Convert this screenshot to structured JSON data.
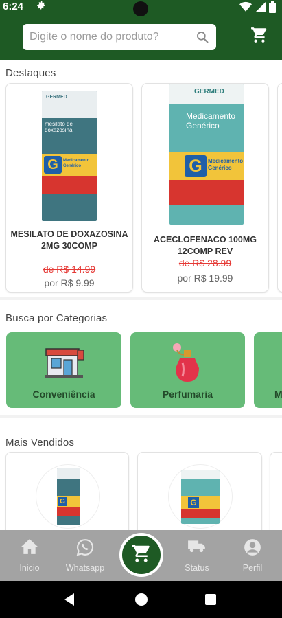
{
  "status_bar": {
    "time": "6:24"
  },
  "header": {
    "search_placeholder": "Digite o nome do produto?"
  },
  "sections": {
    "highlights_title": "Destaques",
    "categories_title": "Busca por Categorias",
    "best_sellers_title": "Mais Vendidos"
  },
  "highlights": [
    {
      "name": "MESILATO DE DOXAZOSINA 2MG 30COMP",
      "old_price": "de R$ 14.99",
      "new_price": "por R$ 9.99",
      "brand": "GERMED",
      "box_title": "mesilato de doxazosina",
      "box_line": "Medicamento Genérico"
    },
    {
      "name": "ACECLOFENACO 100MG 12COMP REV",
      "old_price": "de R$ 28.99",
      "new_price": "por R$ 19.99",
      "brand": "GERMED",
      "box_title": "Medicamento Genérico",
      "box_line": "Medicamento Genérico"
    }
  ],
  "categories": [
    {
      "label": "Conveniência",
      "icon": "store-icon"
    },
    {
      "label": "Perfumaria",
      "icon": "perfume-icon"
    },
    {
      "label": "M",
      "icon": "category-icon"
    }
  ],
  "bottom_nav": [
    {
      "label": "Inicio",
      "icon": "home-icon"
    },
    {
      "label": "Whatsapp",
      "icon": "whatsapp-icon"
    },
    {
      "label": "Status",
      "icon": "truck-icon"
    },
    {
      "label": "Perfil",
      "icon": "profile-icon"
    }
  ],
  "colors": {
    "primary": "#1e5a24",
    "category": "#66bb78",
    "old_price": "#e53935",
    "nav": "#a3a3a3"
  }
}
